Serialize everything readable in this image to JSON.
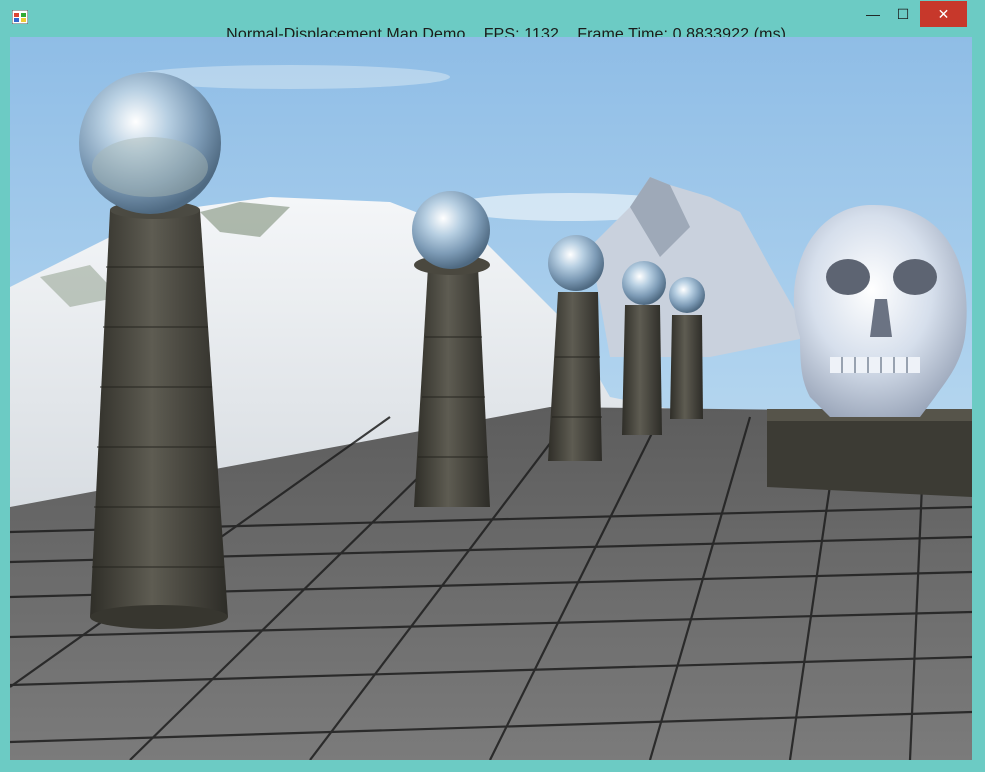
{
  "window": {
    "title": "Normal-Displacement Map Demo",
    "fps_text": "FPS: 1132",
    "frame_time_text": "Frame Time: 0.8833922 (ms)",
    "controls": {
      "minimize_glyph": "—",
      "maximize_glyph": "☐",
      "close_glyph": "✕"
    },
    "colors": {
      "frame": "#6ccbc4",
      "close_button": "#c7382b"
    }
  },
  "scene": {
    "icons": [
      "app-icon",
      "minimize-icon",
      "maximize-icon",
      "close-icon"
    ]
  }
}
